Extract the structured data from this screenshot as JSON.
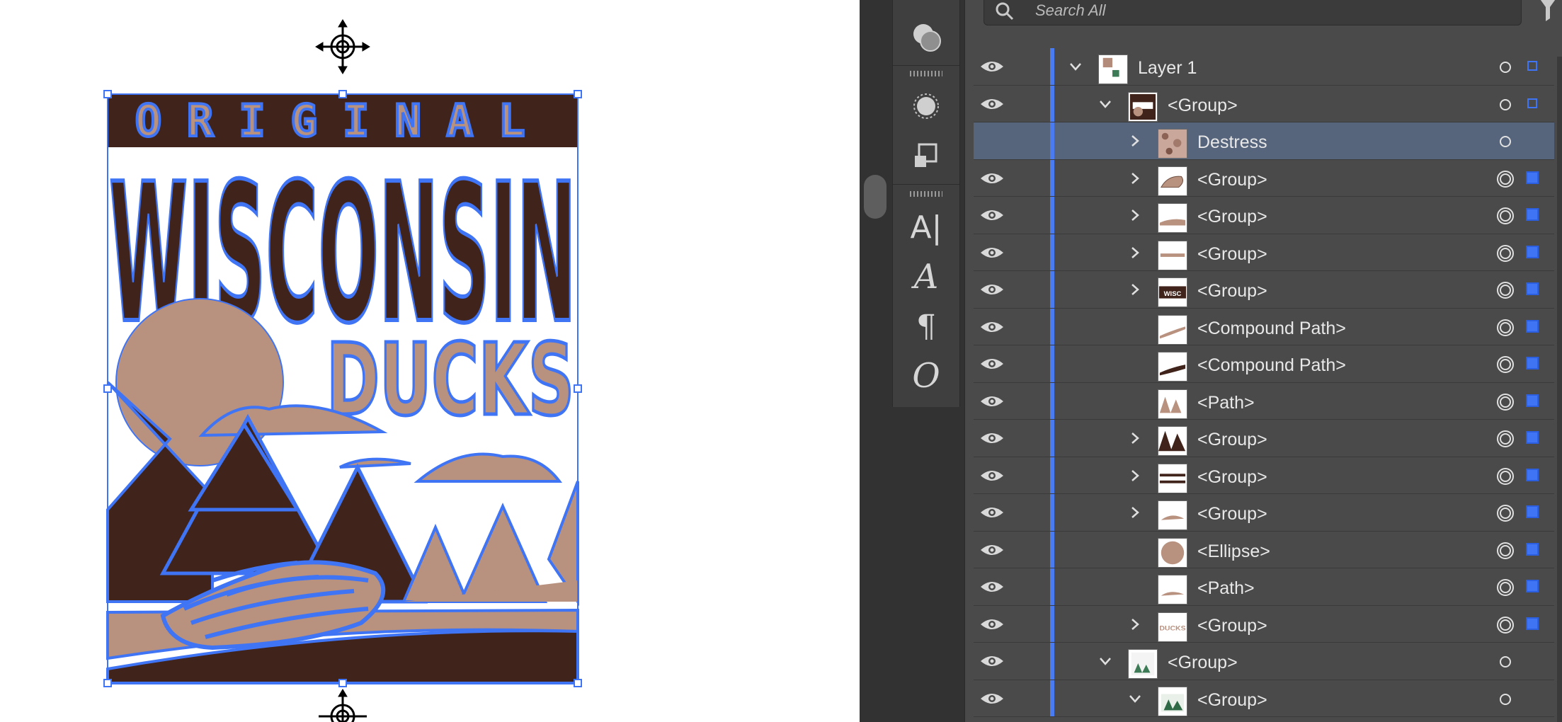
{
  "search": {
    "placeholder": "Search All"
  },
  "artwork": {
    "top_word": "ORIGINAL",
    "main_word": "WISCONSIN",
    "sub_word": "DUCKS",
    "colors": {
      "dark": "#40231a",
      "tan": "#b8917f",
      "selection": "#3f74f5"
    }
  },
  "tools": [
    {
      "name": "shape-builder-icon"
    },
    {
      "name": "blob-icon"
    },
    {
      "name": "transform-icon"
    },
    {
      "name": "character-icon",
      "glyph": "A|"
    },
    {
      "name": "character-style-icon",
      "glyph": "A"
    },
    {
      "name": "paragraph-icon",
      "glyph": "¶"
    },
    {
      "name": "opentype-icon",
      "glyph": "O"
    }
  ],
  "layers": [
    {
      "name": "Layer 1",
      "indent": 0,
      "chevron": "down",
      "eye": true,
      "selected": false,
      "target": "hollow",
      "box": "outline",
      "thumb": "layer"
    },
    {
      "name": "<Group>",
      "indent": 1,
      "chevron": "down",
      "eye": true,
      "selected": false,
      "target": "hollow",
      "box": "outline",
      "thumb": "poster"
    },
    {
      "name": "Destress",
      "indent": 2,
      "chevron": "right",
      "eye": false,
      "selected": true,
      "target": "hollow",
      "box": "none",
      "thumb": "texture"
    },
    {
      "name": "<Group>",
      "indent": 2,
      "chevron": "right",
      "eye": true,
      "selected": false,
      "target": "ring",
      "box": "fill",
      "thumb": "duck"
    },
    {
      "name": "<Group>",
      "indent": 2,
      "chevron": "right",
      "eye": true,
      "selected": false,
      "target": "ring",
      "box": "fill",
      "thumb": "hill"
    },
    {
      "name": "<Group>",
      "indent": 2,
      "chevron": "right",
      "eye": true,
      "selected": false,
      "target": "ring",
      "box": "fill",
      "thumb": "original"
    },
    {
      "name": "<Group>",
      "indent": 2,
      "chevron": "right",
      "eye": true,
      "selected": false,
      "target": "ring",
      "box": "fill",
      "thumb": "wisconsin"
    },
    {
      "name": "<Compound Path>",
      "indent": 2,
      "chevron": "none",
      "eye": true,
      "selected": false,
      "target": "ring",
      "box": "fill",
      "thumb": "wave"
    },
    {
      "name": "<Compound Path>",
      "indent": 2,
      "chevron": "none",
      "eye": true,
      "selected": false,
      "target": "ring",
      "box": "fill",
      "thumb": "wave2"
    },
    {
      "name": "<Path>",
      "indent": 2,
      "chevron": "none",
      "eye": true,
      "selected": false,
      "target": "ring",
      "box": "fill",
      "thumb": "trees-tan"
    },
    {
      "name": "<Group>",
      "indent": 2,
      "chevron": "right",
      "eye": true,
      "selected": false,
      "target": "ring",
      "box": "fill",
      "thumb": "trees-dark"
    },
    {
      "name": "<Group>",
      "indent": 2,
      "chevron": "right",
      "eye": true,
      "selected": false,
      "target": "ring",
      "box": "fill",
      "thumb": "stripes"
    },
    {
      "name": "<Group>",
      "indent": 2,
      "chevron": "right",
      "eye": true,
      "selected": false,
      "target": "ring",
      "box": "fill",
      "thumb": "hill2"
    },
    {
      "name": "<Ellipse>",
      "indent": 2,
      "chevron": "none",
      "eye": true,
      "selected": false,
      "target": "ring",
      "box": "fill",
      "thumb": "ellipse"
    },
    {
      "name": "<Path>",
      "indent": 2,
      "chevron": "none",
      "eye": true,
      "selected": false,
      "target": "ring",
      "box": "fill",
      "thumb": "hill3"
    },
    {
      "name": "<Group>",
      "indent": 2,
      "chevron": "right",
      "eye": true,
      "selected": false,
      "target": "ring",
      "box": "fill",
      "thumb": "ducks"
    },
    {
      "name": "<Group>",
      "indent": 1,
      "chevron": "down",
      "eye": true,
      "selected": false,
      "target": "hollow",
      "box": "none",
      "thumb": "poster-green"
    },
    {
      "name": "<Group>",
      "indent": 2,
      "chevron": "down",
      "eye": true,
      "selected": false,
      "target": "hollow",
      "box": "none",
      "thumb": "green"
    }
  ]
}
